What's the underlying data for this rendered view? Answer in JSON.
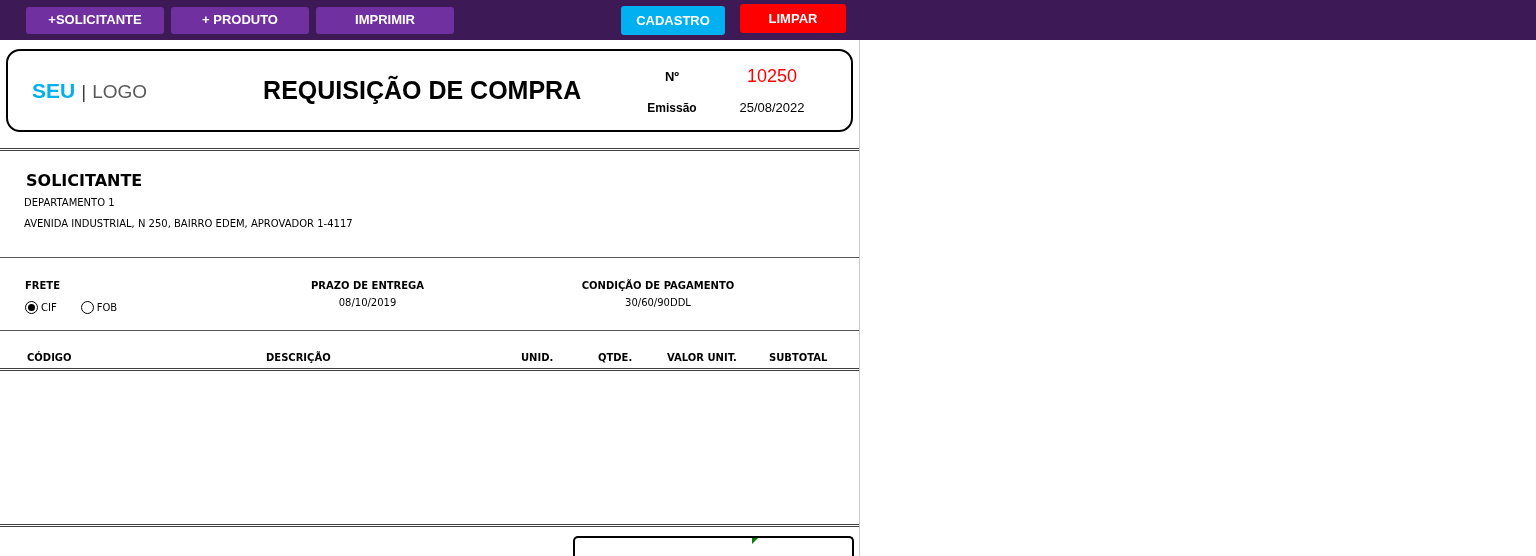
{
  "toolbar": {
    "buttons": [
      {
        "label": "+SOLICITANTE",
        "color": "#7030a0"
      },
      {
        "label": "+ PRODUTO",
        "color": "#7030a0"
      },
      {
        "label": "IMPRIMIR",
        "color": "#7030a0"
      }
    ],
    "right_buttons": [
      {
        "label": "CADASTRO",
        "color": "#00b0f0"
      },
      {
        "label": "LIMPAR",
        "color": "#ff0000"
      }
    ]
  },
  "header": {
    "logo_bold": "SEU",
    "logo_separator": "|",
    "logo_text": "LOGO",
    "title": "REQUISIÇÃO DE COMPRA",
    "number_label": "Nº",
    "number": "10250",
    "issue_label": "Emissão",
    "issue_date": "25/08/2022"
  },
  "requester": {
    "heading": "SOLICITANTE",
    "department": "DEPARTAMENTO 1",
    "address": "AVENIDA INDUSTRIAL, N 250, BAIRRO EDEM, APROVADOR 1-4117"
  },
  "terms": {
    "freight_label": "FRETE",
    "freight_options": [
      {
        "label": "CIF",
        "selected": true
      },
      {
        "label": "FOB",
        "selected": false
      }
    ],
    "delivery_label": "PRAZO DE ENTREGA",
    "delivery_date": "08/10/2019",
    "payment_label": "CONDIÇÃO DE PAGAMENTO",
    "payment": "30/60/90DDL"
  },
  "table": {
    "columns": [
      "CÓDIGO",
      "DESCRIÇÃO",
      "UNID.",
      "QTDE.",
      "VALOR UNIT.",
      "SUBTOTAL"
    ]
  }
}
